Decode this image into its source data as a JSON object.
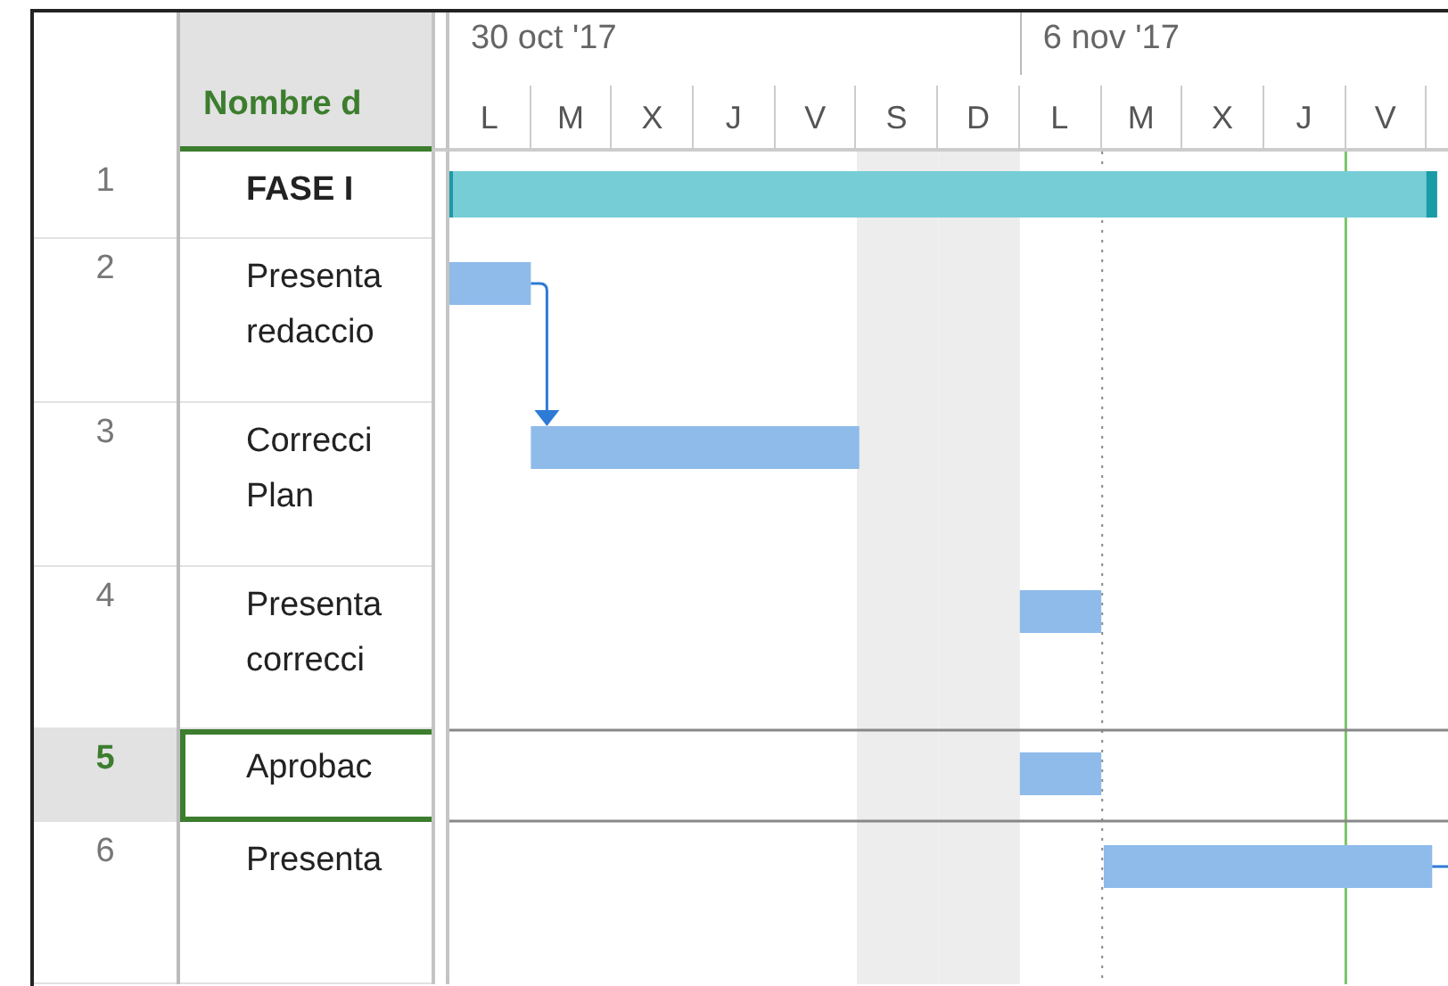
{
  "timescale": {
    "weeks": [
      {
        "label": "30 oct '17"
      },
      {
        "label": "6 nov '17"
      }
    ],
    "days": [
      {
        "label": "L",
        "nonworking": false
      },
      {
        "label": "M",
        "nonworking": false
      },
      {
        "label": "X",
        "nonworking": false
      },
      {
        "label": "J",
        "nonworking": false
      },
      {
        "label": "V",
        "nonworking": false
      },
      {
        "label": "S",
        "nonworking": true
      },
      {
        "label": "D",
        "nonworking": true
      },
      {
        "label": "L",
        "nonworking": false
      },
      {
        "label": "M",
        "nonworking": false
      },
      {
        "label": "X",
        "nonworking": false
      },
      {
        "label": "J",
        "nonworking": false
      },
      {
        "label": "V",
        "nonworking": false
      }
    ]
  },
  "table": {
    "columns": [
      {
        "label": "Nombre d"
      }
    ],
    "rows": [
      {
        "id": "1",
        "kind": "summary",
        "selected": false,
        "name": [
          "FASE I"
        ]
      },
      {
        "id": "2",
        "kind": "task",
        "selected": false,
        "name": [
          "Presenta",
          "redaccio"
        ]
      },
      {
        "id": "3",
        "kind": "task",
        "selected": false,
        "name": [
          "Correcci",
          "Plan"
        ],
        "linked_from_previous": true
      },
      {
        "id": "4",
        "kind": "task",
        "selected": false,
        "name": [
          "Presenta",
          "correcci"
        ]
      },
      {
        "id": "5",
        "kind": "task",
        "selected": true,
        "name": [
          "Aprobac"
        ]
      },
      {
        "id": "6",
        "kind": "task",
        "selected": false,
        "name": [
          "Presenta"
        ],
        "successor_offscreen": true
      }
    ]
  }
}
